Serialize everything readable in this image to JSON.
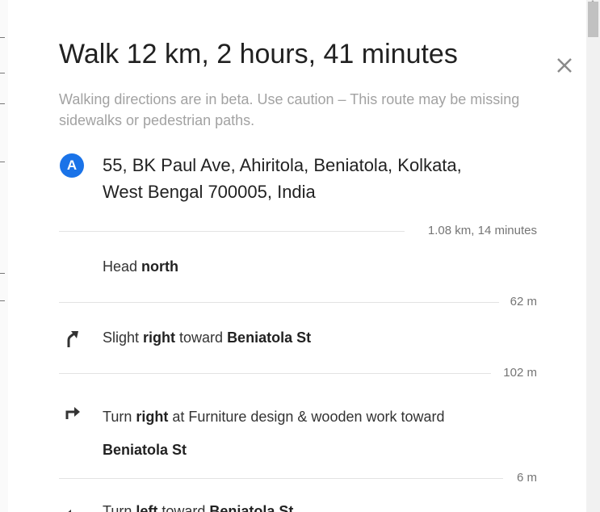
{
  "route": {
    "title": "Walk 12 km, 2 hours, 41 minutes",
    "warning": "Walking directions are in beta. Use caution – This route may be missing sidewalks or pedestrian paths.",
    "close_icon": "close-icon"
  },
  "start": {
    "marker_label": "A",
    "address_line1": "55, BK Paul Ave, Ahiritola, Beniatola, Kolkata,",
    "address_line2": "West Bengal 700005, India"
  },
  "segments": [
    {
      "distance": "1.08 km, 14 minutes"
    }
  ],
  "steps": [
    {
      "icon": "none",
      "prefix": "Head ",
      "bold": "north",
      "mid": "",
      "target": "",
      "distance_after": "62 m"
    },
    {
      "icon": "slight-right-arrow-icon",
      "prefix": "Slight ",
      "bold": "right",
      "mid": " toward ",
      "target": "Beniatola St",
      "distance_after": "102 m"
    },
    {
      "icon": "turn-right-arrow-icon",
      "prefix": "Turn ",
      "bold": "right",
      "mid": " at Furniture design & wooden work toward",
      "target": "Beniatola St",
      "distance_after": "6 m"
    },
    {
      "icon": "turn-left-arrow-icon",
      "prefix": "Turn ",
      "bold": "left",
      "mid": " toward ",
      "target": "Beniatola St",
      "distance_after": ""
    }
  ]
}
